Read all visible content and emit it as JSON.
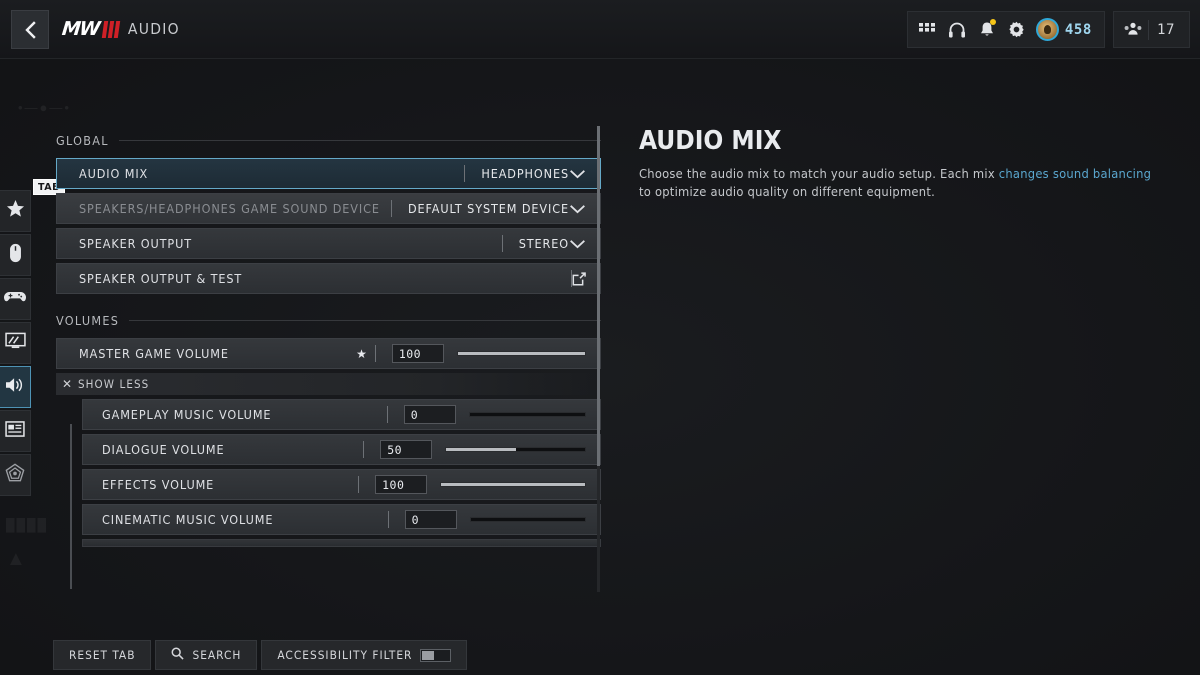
{
  "header": {
    "back_icon": "chevron-left-icon",
    "brand_text": "MW",
    "brand_numeral": "III",
    "title": "AUDIO",
    "icons": [
      {
        "name": "apps-grid-icon",
        "glyph": "grid"
      },
      {
        "name": "headphones-icon",
        "glyph": "headset"
      },
      {
        "name": "notifications-bell-icon",
        "glyph": "bell",
        "badge": true
      },
      {
        "name": "settings-gear-icon",
        "glyph": "gear"
      }
    ],
    "currency": {
      "value": "458",
      "icon": "player-avatar-icon"
    },
    "squad": {
      "value": "17",
      "icon": "squad-icon"
    }
  },
  "rail": {
    "items": [
      {
        "name": "sidebar-item-favorites",
        "icon": "star-icon",
        "active": false
      },
      {
        "name": "sidebar-item-mouse-keyboard",
        "icon": "mouse-icon",
        "active": false
      },
      {
        "name": "sidebar-item-controller",
        "icon": "gamepad-icon",
        "active": false
      },
      {
        "name": "sidebar-item-graphics",
        "icon": "monitor-icon",
        "active": false
      },
      {
        "name": "sidebar-item-audio",
        "icon": "speaker-icon",
        "active": true
      },
      {
        "name": "sidebar-item-interface",
        "icon": "interface-card-icon",
        "active": false
      },
      {
        "name": "sidebar-item-accessibility",
        "icon": "radar-icon",
        "active": false
      }
    ],
    "tab_badge": "TAB"
  },
  "settings": {
    "groups": [
      {
        "label": "GLOBAL",
        "rows": [
          {
            "name": "setting-audio-mix",
            "label": "AUDIO MIX",
            "value": "HEADPHONES",
            "control": "dropdown",
            "selected": true,
            "disabled": false
          },
          {
            "name": "setting-game-sound-device",
            "label": "SPEAKERS/HEADPHONES GAME SOUND DEVICE",
            "value": "DEFAULT SYSTEM DEVICE",
            "control": "dropdown",
            "selected": false,
            "disabled": true
          },
          {
            "name": "setting-speaker-output",
            "label": "SPEAKER OUTPUT",
            "value": "STEREO",
            "control": "dropdown",
            "selected": false,
            "disabled": false
          },
          {
            "name": "setting-speaker-output-test",
            "label": "SPEAKER OUTPUT & TEST",
            "value": "",
            "control": "popout",
            "selected": false,
            "disabled": false
          }
        ]
      },
      {
        "label": "VOLUMES",
        "rows": [
          {
            "name": "setting-master-game-volume",
            "label": "MASTER GAME VOLUME",
            "value": "100",
            "percent": 100,
            "control": "slider",
            "starred": true,
            "indent": false
          },
          {
            "name": "setting-gameplay-music-volume",
            "label": "GAMEPLAY MUSIC VOLUME",
            "value": "0",
            "percent": 0,
            "control": "slider",
            "starred": false,
            "indent": true
          },
          {
            "name": "setting-dialogue-volume",
            "label": "DIALOGUE VOLUME",
            "value": "50",
            "percent": 50,
            "control": "slider",
            "starred": false,
            "indent": true
          },
          {
            "name": "setting-effects-volume",
            "label": "EFFECTS VOLUME",
            "value": "100",
            "percent": 100,
            "control": "slider",
            "starred": false,
            "indent": true
          },
          {
            "name": "setting-cinematic-music-volume",
            "label": "CINEMATIC MUSIC VOLUME",
            "value": "0",
            "percent": 0,
            "control": "slider",
            "starred": false,
            "indent": true
          }
        ]
      }
    ],
    "show_less": {
      "label": "SHOW LESS",
      "icon": "close-x-icon"
    }
  },
  "info": {
    "title": "AUDIO MIX",
    "text_before": "Choose the audio mix to match your audio setup. Each mix ",
    "text_link": "changes sound balancing",
    "text_after": " to optimize audio quality on different equipment."
  },
  "bottom": {
    "reset_label": "RESET TAB",
    "search_label": "SEARCH",
    "search_icon": "search-icon",
    "accessibility_label": "ACCESSIBILITY FILTER",
    "accessibility_toggle_on": false
  },
  "colors": {
    "accent_blue": "#65a9c8",
    "link_blue": "#5aa7cf",
    "brand_red": "#cf2027",
    "notification_yellow": "#f5c518"
  }
}
